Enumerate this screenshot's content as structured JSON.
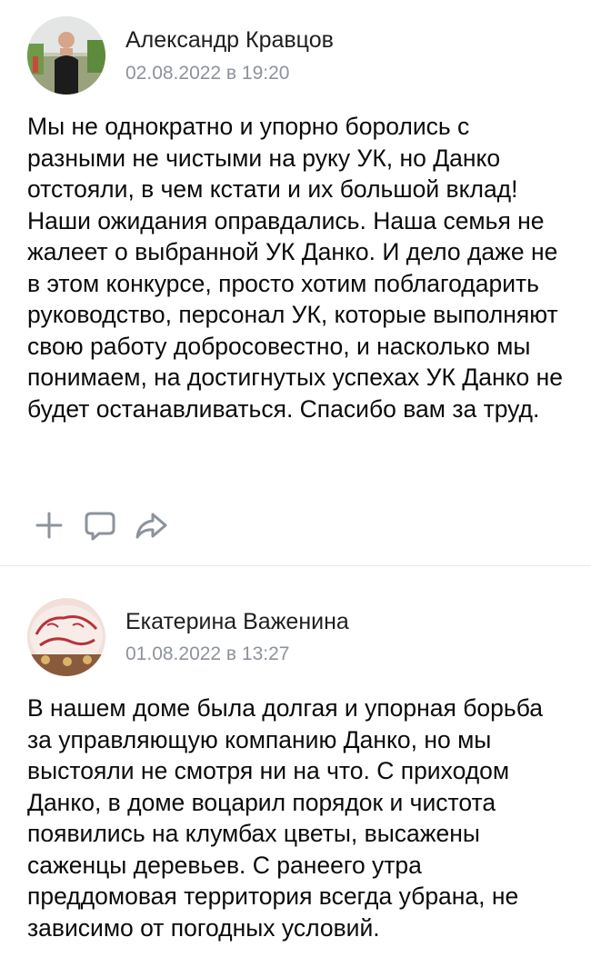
{
  "posts": [
    {
      "author": "Александр Кравцов",
      "date": "02.08.2022 в 19:20",
      "text": "Мы не однократно и упорно боролись с разными не чистыми на руку УК, но Данко отстояли, в чем кстати и их большой вклад! Наши ожидания оправдались. Наша семья не жалеет о выбранной УК Данко. И дело даже не в этом конкурсе, просто хотим поблагодарить руководство, персонал УК, которые выполняют свою работу добросовестно, и насколько мы понимаем, на достигнутых успехах УК Данко не будет останавливаться. Спасибо вам за труд."
    },
    {
      "author": "Екатерина Важенина",
      "date": "01.08.2022 в 13:27",
      "text": "В нашем доме была долгая и упорная борьба за управляющую компанию Данко, но мы выстояли не смотря ни на что. С приходом Данко, в доме воцарил порядок и чистота появились на клумбах цветы, высажены саженцы деревьев. С ранеего утра преддомовая территория всегда убрана, не зависимо от погодных условий."
    }
  ],
  "actions": {
    "add_icon": "plus-icon",
    "comment_icon": "comment-icon",
    "share_icon": "share-icon"
  },
  "colors": {
    "meta_text": "#8d939b",
    "icon": "#8d939b",
    "divider": "#e6e8eb"
  }
}
